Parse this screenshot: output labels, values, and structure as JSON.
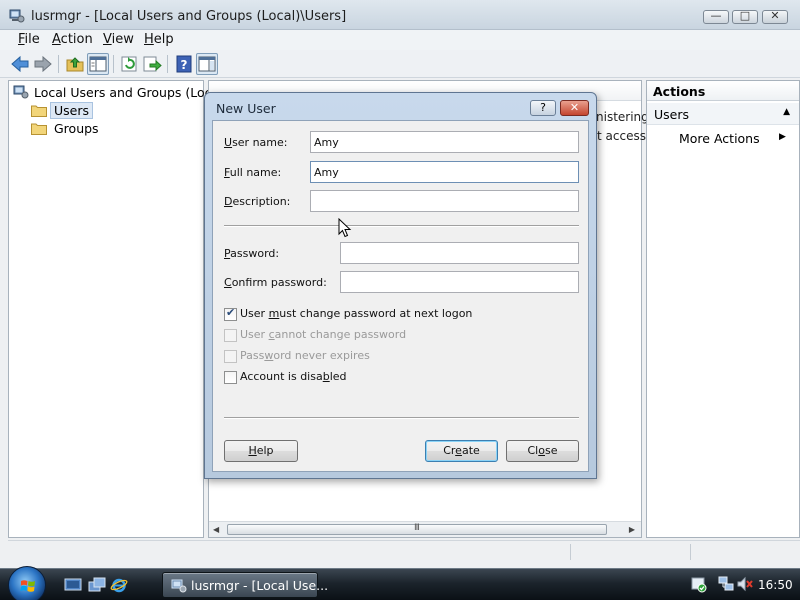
{
  "window": {
    "title": "lusrmgr - [Local Users and Groups (Local)\\Users]",
    "controls": {
      "minimize": "—",
      "maximize": "□",
      "close": "✕"
    }
  },
  "menu": [
    {
      "pre": "",
      "ul": "F",
      "post": "ile"
    },
    {
      "pre": "",
      "ul": "A",
      "post": "ction"
    },
    {
      "pre": "",
      "ul": "V",
      "post": "iew"
    },
    {
      "pre": "",
      "ul": "H",
      "post": "elp"
    }
  ],
  "toolbar": {
    "icons": [
      "back-icon",
      "forward-icon",
      "up-folder-icon",
      "show-hide-tree-icon",
      "refresh-icon",
      "export-icon",
      "help-icon",
      "show-hide-action-pane-icon"
    ]
  },
  "tree": {
    "root": "Local Users and Groups (Local)",
    "items": [
      "Users",
      "Groups"
    ],
    "selected": "Users"
  },
  "center": {
    "bg_text_1": "nistering",
    "bg_text_2": "t access t",
    "scroll_grip": "III"
  },
  "actions": {
    "header": "Actions",
    "section": "Users",
    "section_arrow": "▲",
    "item": "More Actions",
    "item_arrow": "▶"
  },
  "dialog": {
    "title": "New User",
    "help_btn": "?",
    "close_btn": "✕",
    "fields": {
      "username": {
        "pre": "",
        "ul": "U",
        "post": "ser name:",
        "value": "Amy"
      },
      "fullname": {
        "pre": "",
        "ul": "F",
        "post": "ull name:",
        "value": "Amy"
      },
      "description": {
        "pre": "",
        "ul": "D",
        "post": "escription:",
        "value": ""
      },
      "password": {
        "pre": "",
        "ul": "P",
        "post": "assword:",
        "value": ""
      },
      "confirm": {
        "pre": "",
        "ul": "C",
        "post": "onfirm password:",
        "value": ""
      }
    },
    "checkboxes": [
      {
        "pre": "User ",
        "ul": "m",
        "post": "ust change password at next logon",
        "checked": true,
        "enabled": true
      },
      {
        "pre": "User ",
        "ul": "c",
        "post": "annot change password",
        "checked": false,
        "enabled": false
      },
      {
        "pre": "Pass",
        "ul": "w",
        "post": "ord never expires",
        "checked": false,
        "enabled": false
      },
      {
        "pre": "Account is disa",
        "ul": "b",
        "post": "led",
        "checked": false,
        "enabled": true
      }
    ],
    "buttons": {
      "help": {
        "pre": "",
        "ul": "H",
        "post": "elp"
      },
      "create": {
        "pre": "Cr",
        "ul": "e",
        "post": "ate"
      },
      "close": {
        "pre": "Cl",
        "ul": "o",
        "post": "se"
      }
    },
    "check_mark": "✔"
  },
  "taskbar": {
    "task_label": "lusrmgr - [Local Use...",
    "clock": "16:50",
    "colors": {
      "accent": "#2b74c4"
    }
  }
}
